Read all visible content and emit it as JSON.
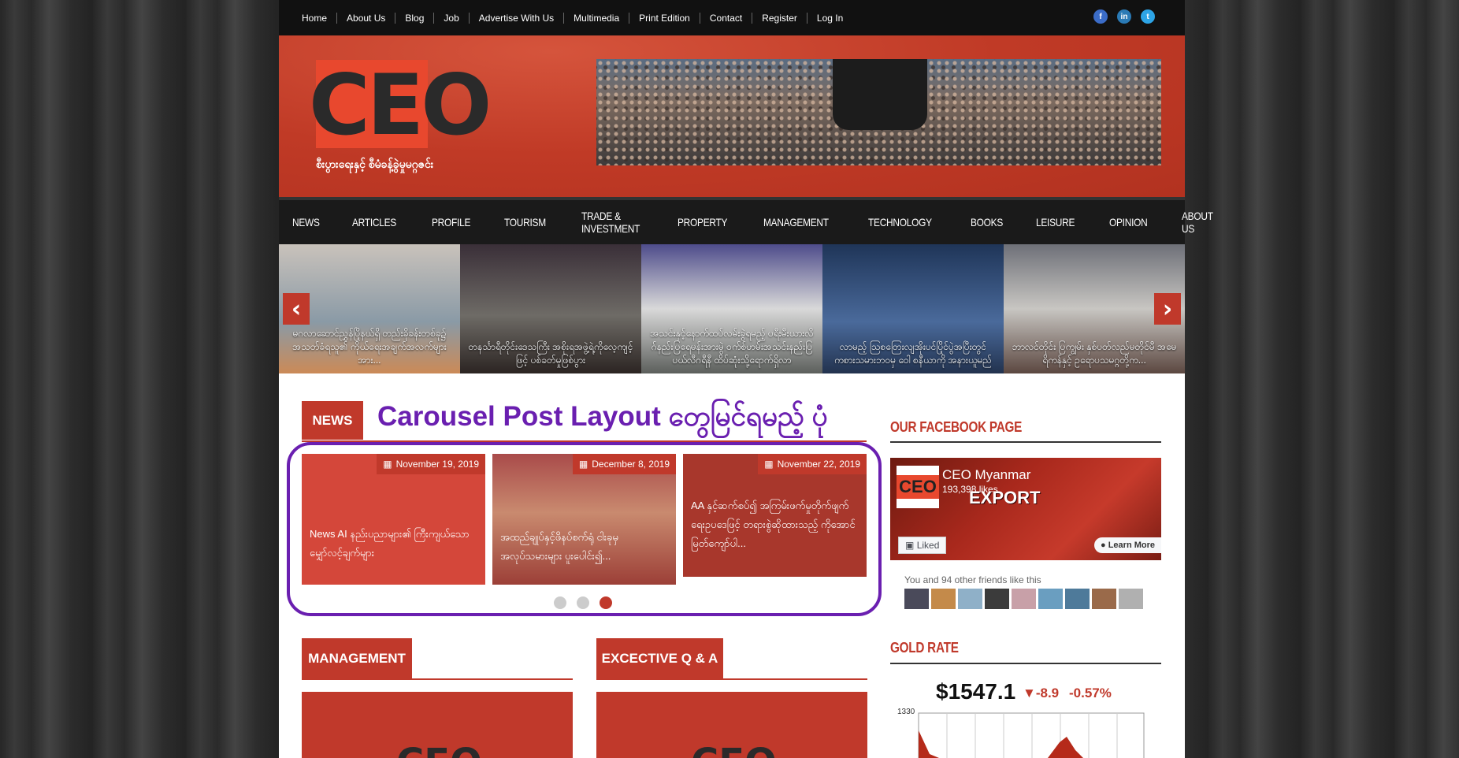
{
  "top_nav": [
    "Home",
    "About Us",
    "Blog",
    "Job",
    "Advertise With Us",
    "Multimedia",
    "Print Edition",
    "Contact",
    "Register",
    "Log In"
  ],
  "social": {
    "facebook": "f",
    "linkedin": "in",
    "twitter": "t"
  },
  "header": {
    "logo": "CEO",
    "tagline": "စီးပွားရေးနှင့် စီမံခန့်ခွဲမှုမဂ္ဂဇင်း"
  },
  "main_nav": [
    "NEWS",
    "ARTICLES",
    "PROFILE",
    "TOURISM",
    "TRADE & INVESTMENT",
    "PROPERTY",
    "MANAGEMENT",
    "TECHNOLOGY",
    "BOOKS",
    "LEISURE",
    "OPINION",
    "ABOUT US"
  ],
  "slider": {
    "prev_label": "‹",
    "next_label": "›",
    "items": [
      "မဂလာဆောင်ညွှန်ပြိုနယ်ရှိ တည်းခိုခန်းတစ်ခု၌ အသတ်ခံရသူ၏ ကိုယ်ရေးအချက်အလက်များအား...",
      "တနင်္သာရီတိုင်းဒေသကြီး အစိုးရအဖွဲ့ရဲ့ကိုလေ့ကျင့်ဖြင့် ပစ်ခတ်မှုဖြစ်ပွား",
      "အသင်းနှင့်နောက်ထပ်လမ်းခွဲရမည့် ပရီးမီးယားလိဂ်နည်းပြရေမန်းအားမွဲ ဝက်စ်ဟမ်းအသင်းနည်းပြ ပယ်လီဂရီနီ ထိပ်ဆုံးသို့ရောက်ရှိလာ",
      "လာမည့် ဩစတြေးလျအိုးပင်ပြိုင်ပွဲအပြီးတွင် ကစားသမားဘဝမှ ဝေါ စနီယာကို အနားယူမည်",
      "ဘာလင်တိုင်း ပြကျွမ်း နှစ်ပတ်လည်မတိုင်မီ အမေရိကန်နှင့် ဥရောပသမဂ္ဂတို့က..."
    ]
  },
  "news_section": {
    "tab": "NEWS",
    "overlay_title": "Carousel Post Layout တွေမြင်ရမည့် ပုံ",
    "cards": [
      {
        "date": "November 19, 2019",
        "title": "News AI နည်းပညာများ၏ ကြီးကျယ်သောမျှော်လင့်ချက်များ"
      },
      {
        "date": "December 8, 2019",
        "title": "အထည်ချုပ်နှင့်ဖိနပ်စက်ရုံ ငါးခုမှ အလုပ်သမားများ ပူးပေါင်း၍..."
      },
      {
        "date": "November 22, 2019",
        "title": "AA နှင့်ဆက်စပ်၍ အကြမ်းဖက်မှုတိုက်ဖျက်ရေးဥပဒေဖြင့် တရားစွဲဆိုထားသည့် ကိုအောင်မြတ်ကျော်ပါ..."
      }
    ],
    "dots": 3,
    "active_dot": 3
  },
  "management_tab": "MANAGEMENT",
  "qa_tab": "EXCECTIVE Q & A",
  "sidebar": {
    "facebook_title": "OUR FACEBOOK PAGE",
    "fb_name": "CEO Myanmar",
    "fb_likes": "193,398 likes",
    "fb_logo": "CEO",
    "fb_cover_text": "EXPORT",
    "fb_liked": "Liked",
    "fb_learn": "Learn More",
    "fb_friends": "You and 94 other friends like this",
    "gold_title": "GOLD RATE",
    "gold_price": "$1547.1",
    "gold_change": "▼-8.9",
    "gold_pct": "-0.57%",
    "gold_axis_top": "1330"
  },
  "colors": {
    "brand_red": "#c0392b",
    "overlay_purple": "#6a1fb0",
    "nav_dark": "#1a1a1a"
  }
}
